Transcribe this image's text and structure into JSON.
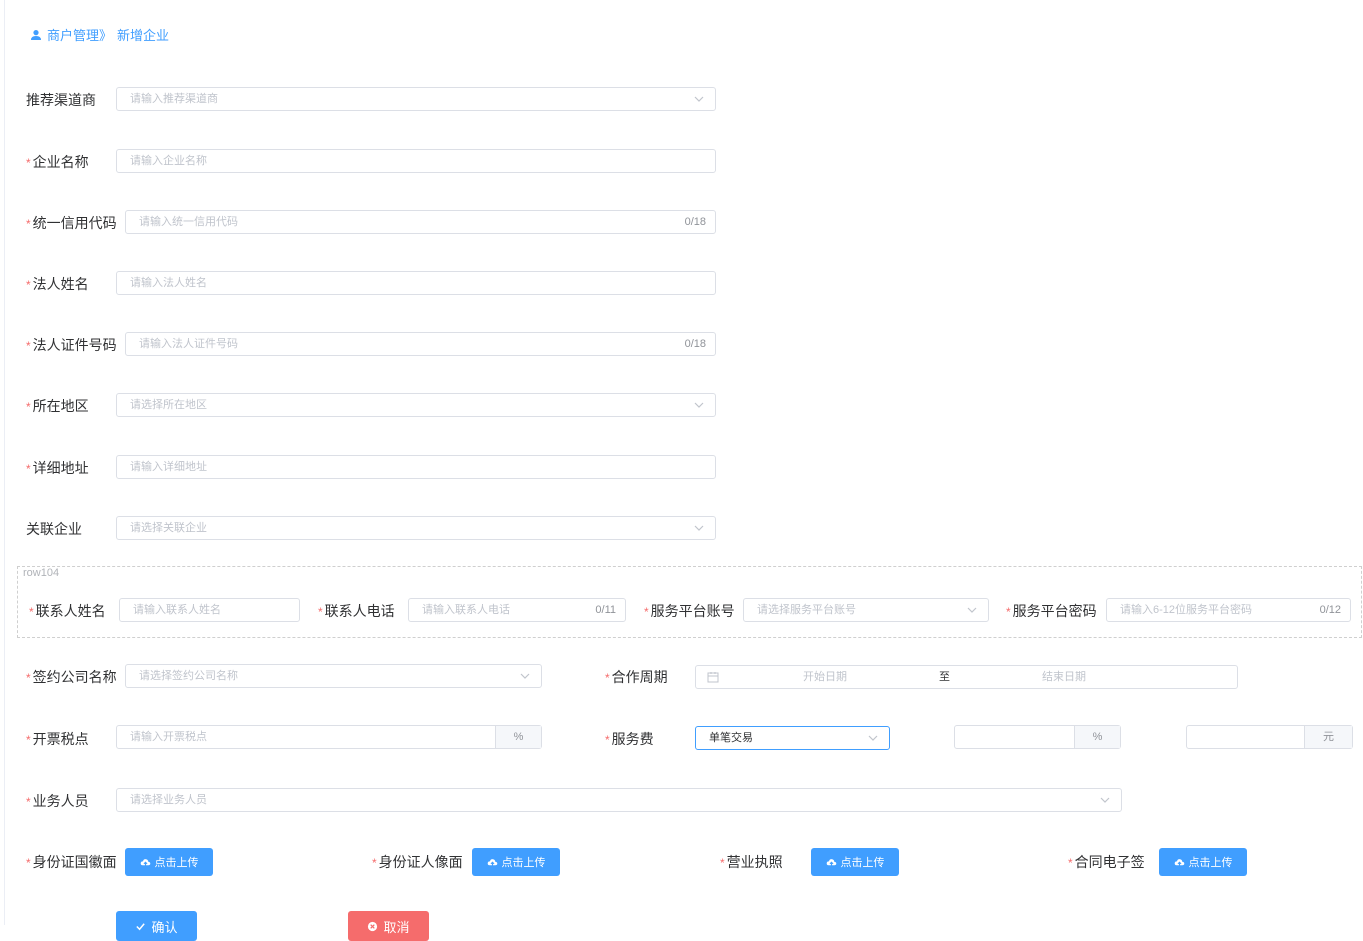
{
  "breadcrumb": {
    "parent": "商户管理》",
    "current": "新增企业"
  },
  "fields": {
    "channel": {
      "label": "推荐渠道商",
      "placeholder": "请输入推荐渠道商"
    },
    "company_name": {
      "label": "企业名称",
      "placeholder": "请输入企业名称"
    },
    "credit_code": {
      "label": "统一信用代码",
      "placeholder": "请输入统一信用代码",
      "count": "0/18"
    },
    "legal_name": {
      "label": "法人姓名",
      "placeholder": "请输入法人姓名"
    },
    "legal_id": {
      "label": "法人证件号码",
      "placeholder": "请输入法人证件号码",
      "count": "0/18"
    },
    "region": {
      "label": "所在地区",
      "placeholder": "请选择所在地区"
    },
    "address": {
      "label": "详细地址",
      "placeholder": "请输入详细地址"
    },
    "related": {
      "label": "关联企业",
      "placeholder": "请选择关联企业"
    }
  },
  "row104": {
    "tag": "row104",
    "contact_name": {
      "label": "联系人姓名",
      "placeholder": "请输入联系人姓名"
    },
    "contact_phone": {
      "label": "联系人电话",
      "placeholder": "请输入联系人电话",
      "count": "0/11"
    },
    "platform_account": {
      "label": "服务平台账号",
      "placeholder": "请选择服务平台账号"
    },
    "platform_password": {
      "label": "服务平台密码",
      "placeholder": "请输入6-12位服务平台密码",
      "count": "0/12"
    }
  },
  "contract": {
    "company": {
      "label": "签约公司名称",
      "placeholder": "请选择签约公司名称"
    },
    "period": {
      "label": "合作周期",
      "start_placeholder": "开始日期",
      "separator": "至",
      "end_placeholder": "结束日期"
    }
  },
  "tax": {
    "label": "开票税点",
    "placeholder": "请输入开票税点",
    "unit": "%"
  },
  "service_fee": {
    "label": "服务费",
    "selected": "单笔交易",
    "percent_unit": "%",
    "yuan_unit": "元"
  },
  "sales": {
    "label": "业务人员",
    "placeholder": "请选择业务人员"
  },
  "uploads": {
    "button_label": "点击上传",
    "items": [
      {
        "label": "身份证国徽面"
      },
      {
        "label": "身份证人像面"
      },
      {
        "label": "营业执照"
      },
      {
        "label": "合同电子签"
      }
    ]
  },
  "actions": {
    "confirm": "确认",
    "cancel": "取消"
  },
  "required_mark": "*",
  "colors": {
    "primary": "#409eff",
    "danger": "#f56c6c",
    "required": "#f56c6c"
  }
}
